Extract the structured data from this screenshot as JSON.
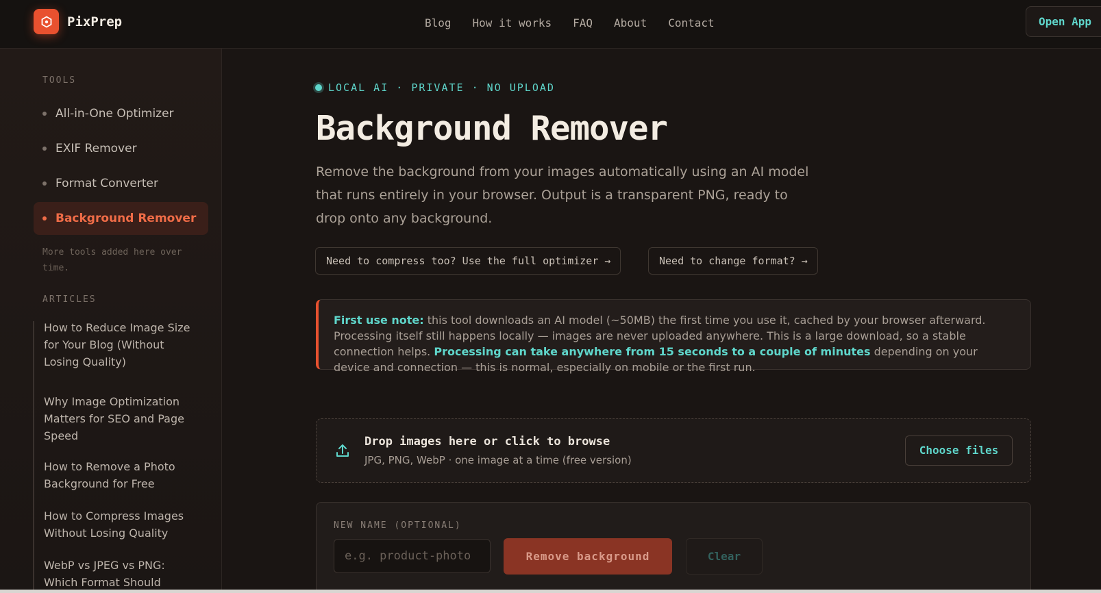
{
  "brand": {
    "name": "PixPrep",
    "logo_icon": "hexagon-icon",
    "accent": "#e8512f",
    "teal": "#5fd6cb"
  },
  "nav": {
    "items": [
      "Blog",
      "How it works",
      "FAQ",
      "About",
      "Contact"
    ],
    "cta": "Open App"
  },
  "sidebar": {
    "tools_heading": "TOOLS",
    "tools": [
      {
        "label": "All-in-One Optimizer"
      },
      {
        "label": "EXIF Remover"
      },
      {
        "label": "Format Converter"
      },
      {
        "label": "Background Remover",
        "active": true
      }
    ],
    "note": "More tools added here over time.",
    "articles_heading": "ARTICLES",
    "articles": [
      "How to Reduce Image Size for Your Blog (Without Losing Quality)",
      "Why Image Optimization Matters for SEO and Page Speed",
      "How to Remove a Photo Background for Free",
      "How to Compress Images Without Losing Quality",
      "WebP vs JPEG vs PNG: Which Format Should"
    ]
  },
  "main": {
    "badge": "LOCAL AI · PRIVATE · NO UPLOAD",
    "title": "Background Remover",
    "lede": "Remove the background from your images automatically using an AI model that runs entirely in your browser. Output is a transparent PNG, ready to drop onto any background.",
    "links": [
      "Need to compress too? Use the full optimizer →",
      "Need to change format? →"
    ],
    "note": {
      "lead": "First use note:",
      "text1": " this tool downloads an AI model (~50MB) the first time you use it, cached by your browser afterward. Processing itself still happens locally — images are never uploaded anywhere. This is a large download, so a stable connection helps. ",
      "highlight": "Processing can take anywhere from 15 seconds to a couple of minutes",
      "text2": " depending on your device and connection — this is normal, especially on mobile or the first run."
    },
    "drop": {
      "title": "Drop images here or click to browse",
      "subtitle": "JPG, PNG, WebP · one image at a time (free version)",
      "button": "Choose files",
      "icon": "upload-icon"
    },
    "form": {
      "label": "NEW NAME (OPTIONAL)",
      "placeholder": "e.g. product-photo",
      "remove_button": "Remove background",
      "clear_button": "Clear"
    }
  }
}
